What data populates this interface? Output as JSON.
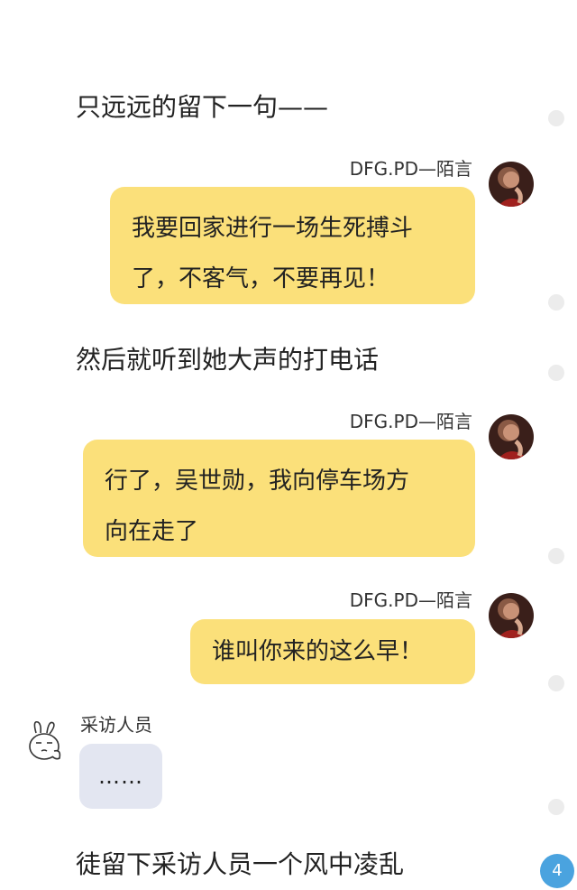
{
  "narration": {
    "first": "只远远的留下一句——",
    "second": "然后就听到她大声的打电话",
    "last": "徒留下采访人员一个风中凌乱"
  },
  "messages": [
    {
      "sender": "DFG.PD—陌言",
      "lines": [
        "我要回家进行一场生死搏斗",
        "了，不客气，不要再见！"
      ]
    },
    {
      "sender": "DFG.PD—陌言",
      "lines": [
        "行了，吴世勋，我向停车场方",
        "向在走了"
      ]
    },
    {
      "sender": "DFG.PD—陌言",
      "lines": [
        "谁叫你来的这么早！"
      ]
    }
  ],
  "reply": {
    "sender": "采访人员",
    "text": "……"
  },
  "page_badge": "4",
  "colors": {
    "bubble_right": "#fbe07a",
    "bubble_left": "#e3e6f1",
    "badge": "#4aa3df"
  },
  "icons": {
    "avatar": "avatar-photo-icon",
    "reply_avatar": "rabbit-face-icon"
  }
}
